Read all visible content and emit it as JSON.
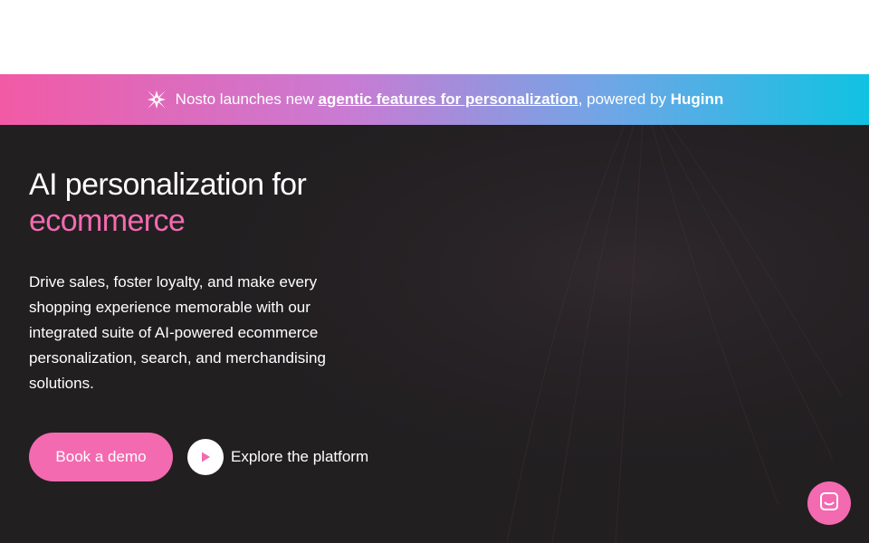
{
  "announcement": {
    "prefix": "Nosto launches new",
    "link_text": "agentic features for personalization",
    "middle": ", powered by",
    "brand": "Huginn"
  },
  "hero": {
    "headline_line1": "AI personalization for",
    "headline_accent": "ecommerce",
    "description": "Drive sales, foster loyalty, and make every shopping experience memorable with our integrated suite of AI-powered ecommerce personalization, search, and merchandising solutions.",
    "primary_cta": "Book a demo",
    "secondary_cta": "Explore the platform"
  },
  "icons": {
    "announcement_logo": "nosto-logo-icon",
    "play": "play-icon",
    "chat": "chat-icon"
  },
  "colors": {
    "accent_pink": "#f36ab0",
    "hero_background": "#221f21",
    "banner_gradient_start": "#f25aa5",
    "banner_gradient_end": "#10c2e2"
  }
}
